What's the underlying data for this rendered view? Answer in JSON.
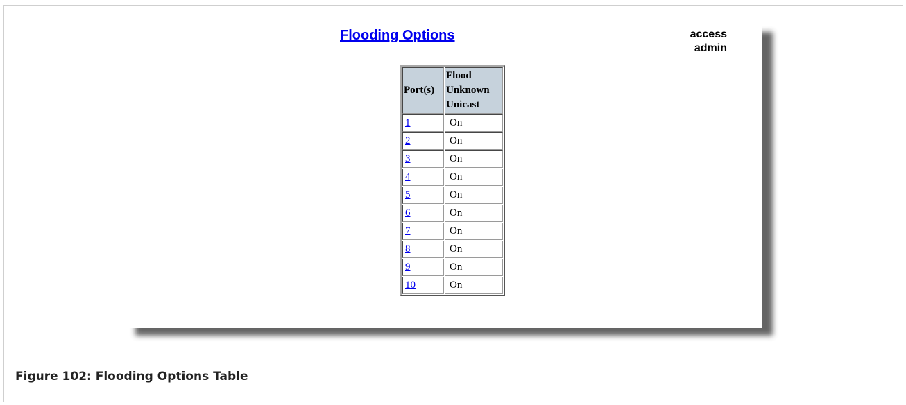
{
  "page": {
    "title": "Flooding Options",
    "user": {
      "line1": "access",
      "line2": "admin"
    }
  },
  "table": {
    "headers": [
      "Port(s)",
      "Flood Unknown Unicast"
    ],
    "header_lines": [
      "Flood",
      "Unknown",
      "Unicast"
    ],
    "rows": [
      {
        "port": "1",
        "value": "On"
      },
      {
        "port": "2",
        "value": "On"
      },
      {
        "port": "3",
        "value": "On"
      },
      {
        "port": "4",
        "value": "On"
      },
      {
        "port": "5",
        "value": "On"
      },
      {
        "port": "6",
        "value": "On"
      },
      {
        "port": "7",
        "value": "On"
      },
      {
        "port": "8",
        "value": "On"
      },
      {
        "port": "9",
        "value": "On"
      },
      {
        "port": "10",
        "value": "On"
      }
    ]
  },
  "caption": "Figure 102: Flooding Options Table",
  "colors": {
    "link": "#0000ee",
    "header_bg": "#c6d2dc"
  }
}
